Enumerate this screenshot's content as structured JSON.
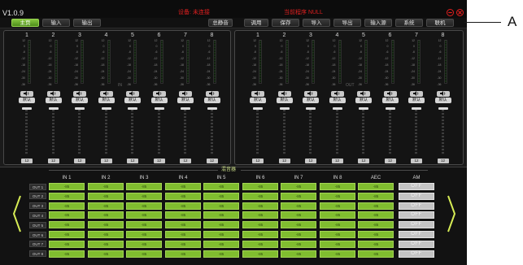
{
  "app": {
    "version": "V1.0.9",
    "device_status": "设备: 未连接",
    "program_status": "当前程序 NULL",
    "colors": {
      "accent": "#7fbf2f",
      "warning": "#e11f1f",
      "background": "#1b1b1b"
    }
  },
  "nav": {
    "tabs": [
      {
        "label": "主页",
        "active": true
      },
      {
        "label": "输入",
        "active": false
      },
      {
        "label": "输出",
        "active": false
      }
    ],
    "buttons": [
      "总静音",
      "调用",
      "保存",
      "导入",
      "导出",
      "输入源",
      "系统",
      "联机"
    ]
  },
  "meter_scale": [
    "12",
    "0",
    "-6",
    "-12",
    "-18",
    "-24",
    "-30",
    "-36"
  ],
  "input_panel": {
    "tag": "IN",
    "channels": [
      "1",
      "2",
      "3",
      "4",
      "5",
      "6",
      "7",
      "8"
    ],
    "mute_icon": "speaker-icon",
    "invert_label": "默认",
    "fader_value": "12"
  },
  "output_panel": {
    "tag": "OUT",
    "channels": [
      "1",
      "2",
      "3",
      "4",
      "5",
      "6",
      "7",
      "8"
    ],
    "mute_icon": "speaker-icon",
    "invert_label": "默认",
    "fader_value": "12"
  },
  "matrix": {
    "title": "混音器",
    "columns": [
      "IN 1",
      "IN 2",
      "IN 3",
      "IN 4",
      "IN 5",
      "IN 6",
      "IN 7",
      "IN 8",
      "AEC",
      "AM"
    ],
    "rows": [
      "OUT 1",
      "OUT 2",
      "OUT 3",
      "OUT 4",
      "OUT 5",
      "OUT 6",
      "OUT 7",
      "OUT 8"
    ],
    "cell_value": "-85",
    "am_value": "OFF"
  },
  "annotation": {
    "letter": "A"
  }
}
